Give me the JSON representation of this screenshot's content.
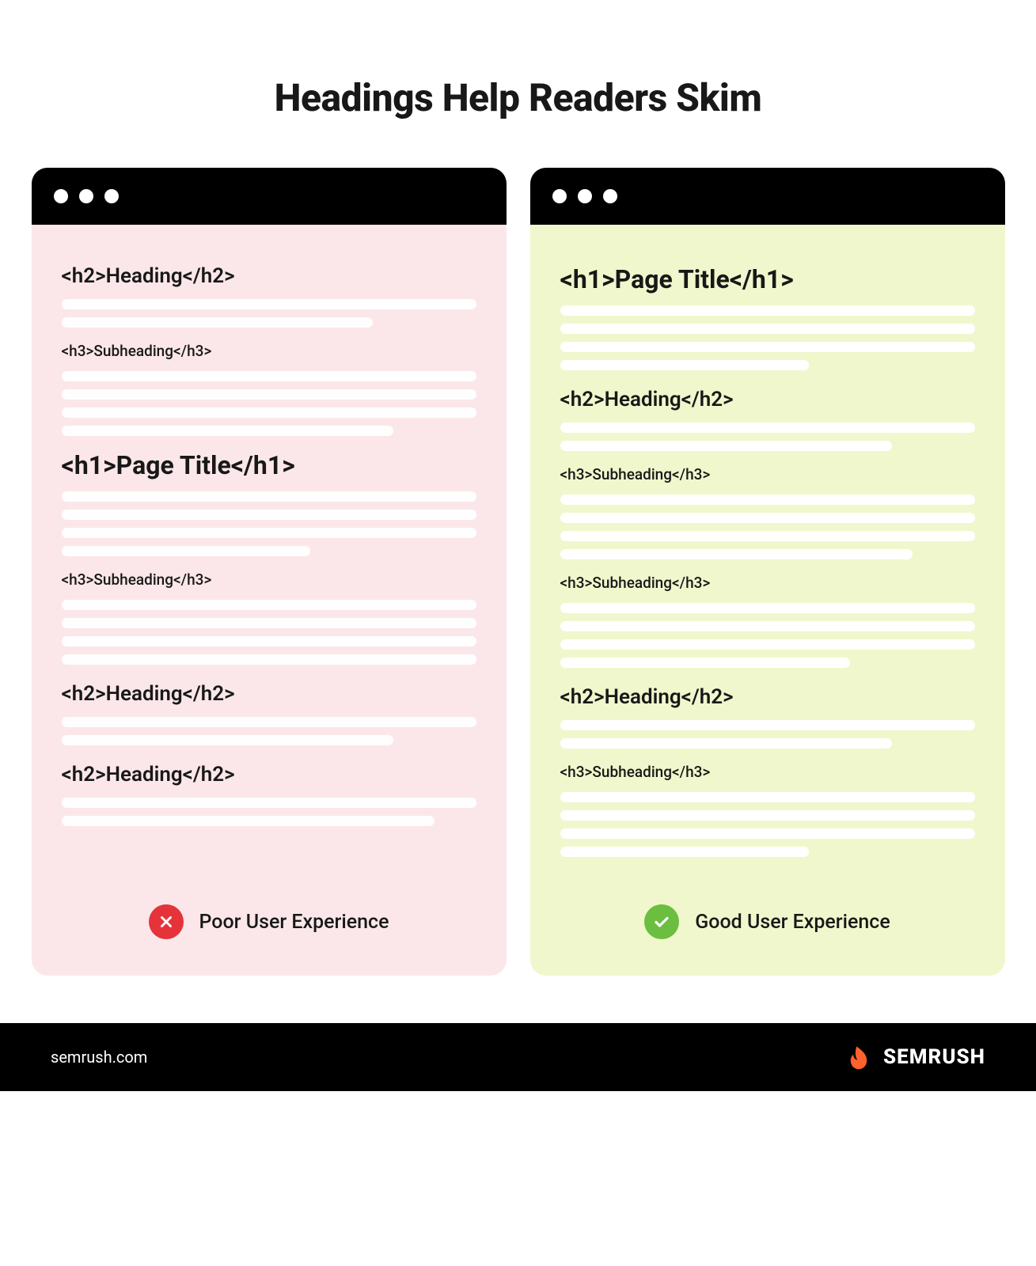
{
  "title": "Headings Help Readers Skim",
  "panels": {
    "bad": {
      "caption": "Poor User Experience",
      "blocks": [
        {
          "level": "h2",
          "text": "<h2>Heading</h2>",
          "lines": [
            100,
            75
          ]
        },
        {
          "level": "h3",
          "text": "<h3>Subheading</h3>",
          "lines": [
            100,
            100,
            100,
            80
          ]
        },
        {
          "level": "h1",
          "text": "<h1>Page Title</h1>",
          "lines": [
            100,
            100,
            100,
            60
          ]
        },
        {
          "level": "h3",
          "text": "<h3>Subheading</h3>",
          "lines": [
            100,
            100,
            100,
            100
          ]
        },
        {
          "level": "h2",
          "text": "<h2>Heading</h2>",
          "lines": [
            100,
            80
          ]
        },
        {
          "level": "h2",
          "text": "<h2>Heading</h2>",
          "lines": [
            100,
            90
          ]
        }
      ]
    },
    "good": {
      "caption": "Good User Experience",
      "blocks": [
        {
          "level": "h1",
          "text": "<h1>Page Title</h1>",
          "lines": [
            100,
            100,
            100,
            60
          ]
        },
        {
          "level": "h2",
          "text": "<h2>Heading</h2>",
          "lines": [
            100,
            80
          ]
        },
        {
          "level": "h3",
          "text": "<h3>Subheading</h3>",
          "lines": [
            100,
            100,
            100,
            85
          ]
        },
        {
          "level": "h3",
          "text": "<h3>Subheading</h3>",
          "lines": [
            100,
            100,
            100,
            70
          ]
        },
        {
          "level": "h2",
          "text": "<h2>Heading</h2>",
          "lines": [
            100,
            80
          ]
        },
        {
          "level": "h3",
          "text": "<h3>Subheading</h3>",
          "lines": [
            100,
            100,
            100,
            60
          ]
        }
      ]
    }
  },
  "footer": {
    "site": "semrush.com",
    "brand": "SEMRUSH"
  }
}
